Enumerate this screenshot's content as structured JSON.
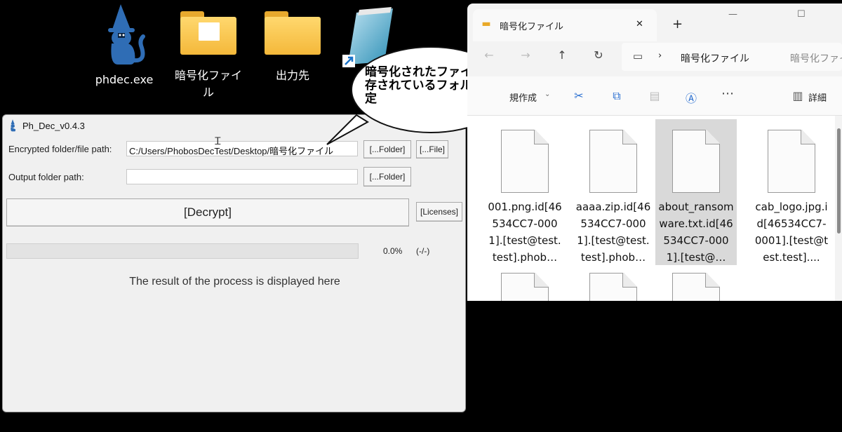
{
  "desktop": {
    "icons": [
      {
        "label": "phdec.exe",
        "icon": "wizard-cat-icon"
      },
      {
        "label": "暗号化ファイル",
        "icon": "folder-icon"
      },
      {
        "label": "出力先",
        "icon": "folder-icon"
      },
      {
        "label": "",
        "icon": "notepad-shortcut-icon"
      }
    ]
  },
  "app": {
    "title": "Ph_Dec_v0.4.3",
    "encrypted_label": "Encrypted folder/file path:",
    "encrypted_value": "C:/Users/PhobosDecTest/Desktop/暗号化ファイル",
    "output_label": "Output folder path:",
    "output_value": "",
    "folder_button": "[...Folder]",
    "file_button": "[...File]",
    "output_folder_button": "[...Folder]",
    "decrypt_button": "[Decrypt]",
    "licenses_button": "[Licenses]",
    "progress_percent": "0.0%",
    "progress_count": "(-/-)",
    "progress_fraction": 0.0,
    "result_text": "The result of the process is displayed here"
  },
  "callout": {
    "text": "暗号化されたファイルが保存されているフォルダを指定"
  },
  "explorer": {
    "tab_title": "暗号化ファイル",
    "close_symbol": "✕",
    "new_tab_symbol": "+",
    "breadcrumb": "暗号化ファイル",
    "address_right": "暗号化ファイル",
    "new_label": "規作成",
    "details_label": "詳細",
    "files": [
      {
        "name": "001.png.id[46534CC7-0001].[test@test.test].phob…",
        "selected": false
      },
      {
        "name": "aaaa.zip.id[46534CC7-0001].[test@test.test].phob…",
        "selected": false
      },
      {
        "name": "about_ransomware.txt.id[46534CC7-0001].[test@…",
        "selected": true
      },
      {
        "name": "cab_logo.jpg.id[46534CC7-0001].[test@test.test]....",
        "selected": false
      }
    ]
  },
  "colors": {
    "desktop_bg": "#000000",
    "app_bg": "#f0f0f0",
    "selection": "#d9d9d9",
    "folder": "#f4b83a",
    "wizard": "#2f6db5"
  }
}
